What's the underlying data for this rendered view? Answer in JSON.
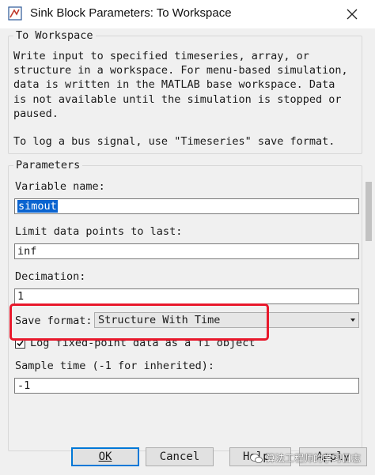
{
  "window": {
    "title": "Sink Block Parameters: To Workspace"
  },
  "block_group": {
    "legend": "To Workspace",
    "description": "Write input to specified timeseries, array, or structure in a workspace. For menu-based simulation, data is written in the MATLAB base workspace. Data is not available until the simulation is stopped or paused.",
    "hint": "To log a bus signal, use \"Timeseries\" save format."
  },
  "parameters": {
    "legend": "Parameters",
    "variable_name_label": "Variable name:",
    "variable_name_value": "simout",
    "limit_label": "Limit data points to last:",
    "limit_value": "inf",
    "decimation_label": "Decimation:",
    "decimation_value": "1",
    "save_format_label": "Save format:",
    "save_format_value": "Structure With Time",
    "log_fixed_point_label": "Log fixed-point data as a fi object",
    "log_fixed_point_checked": true,
    "sample_time_label": "Sample time (-1 for inherited):",
    "sample_time_value": "-1"
  },
  "buttons": {
    "ok": "OK",
    "cancel": "Cancel",
    "help": "Help",
    "apply": "Apply"
  },
  "watermark": {
    "text": "算法工程师的学习日志"
  },
  "colors": {
    "highlight_box": "#e8182b",
    "selection": "#0a64d0",
    "default_button_border": "#0078d7"
  },
  "icons": {
    "window": "simulink-block-icon",
    "close": "close-icon",
    "dropdown": "chevron-down-icon",
    "checkbox": "checkmark-icon",
    "watermark": "wechat-icon"
  }
}
